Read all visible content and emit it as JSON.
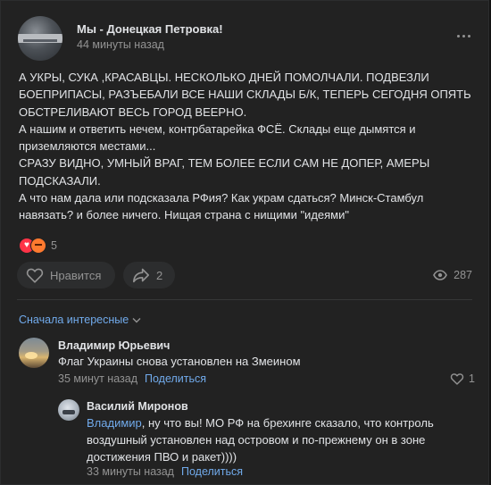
{
  "post": {
    "group_name": "Мы - Донецкая Петровка!",
    "time": "44 минуты назад",
    "text_lines": [
      "А УКРЫ, СУКА ,КРАСАВЦЫ. НЕСКОЛЬКО ДНЕЙ ПОМОЛЧАЛИ. ПОДВЕЗЛИ",
      "БОЕПРИПАСЫ, РАЗЪЕБАЛИ ВСЕ НАШИ СКЛАДЫ Б/К, ТЕПЕРЬ СЕГОДНЯ ОПЯТЬ",
      "ОБСТРЕЛИВАЮТ ВЕСЬ ГОРОД ВЕЕРНО.",
      "А нашим и ответить нечем, контрбатарейка ФСЁ. Склады еще дымятся и",
      "приземляются местами...",
      "СРАЗУ ВИДНО, УМНЫЙ ВРАГ, ТЕМ БОЛЕЕ ЕСЛИ САМ НЕ ДОПЕР, АМЕРЫ",
      "ПОДСКАЗАЛИ.",
      "А что нам дала или подсказала РФия? Как украм сдаться? Минск-Стамбул",
      "навязать? и более ничего. Нищая страна с нищими \"идеями\""
    ],
    "reactions": {
      "icons": [
        "heart-reaction",
        "angry-reaction"
      ],
      "count": "5"
    },
    "like_label": "Нравится",
    "share_count": "2",
    "views": "287"
  },
  "comments": {
    "sort_label": "Сначала интересные",
    "items": [
      {
        "author": "Владимир Юрьевич",
        "text": "Флаг Украины снова установлен на Змеином",
        "time": "35 минут назад",
        "share_label": "Поделиться",
        "likes": "1"
      }
    ],
    "reply": {
      "author": "Василий Миронов",
      "mention": "Владимир",
      "text_line1": ", ну что вы! МО РФ на брехинге сказало, что контроль",
      "text_line2": "воздушный установлен над островом и по-прежнему он в зоне",
      "text_line3": "достижения ПВО и ракет))))",
      "time": "33 минуты назад",
      "share_label": "Поделиться"
    }
  },
  "colors": {
    "background": "#222222",
    "accent": "#71aaeb",
    "muted": "#939393",
    "text": "#e1e3e6"
  }
}
